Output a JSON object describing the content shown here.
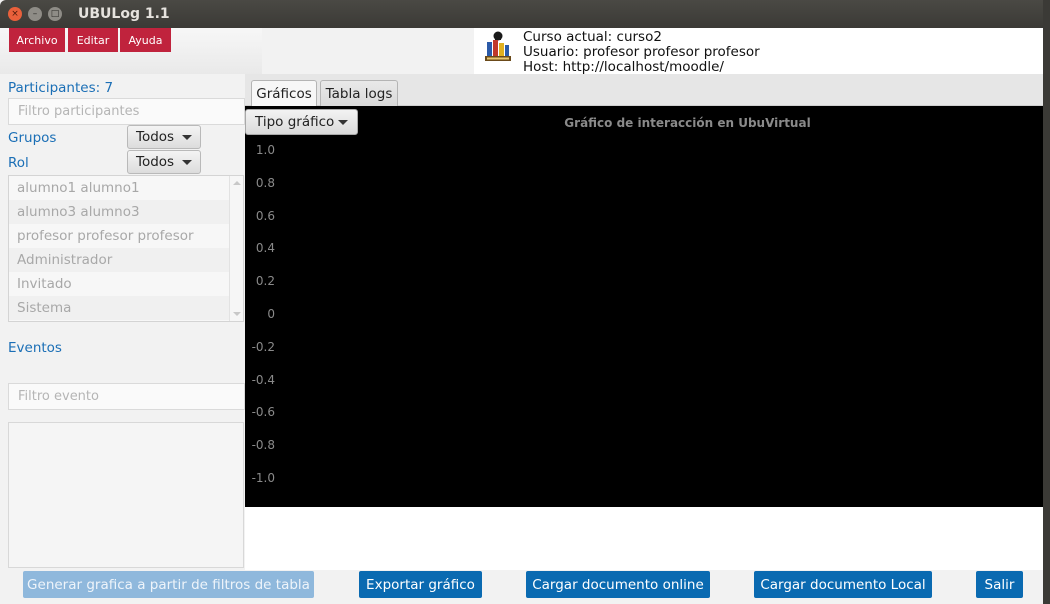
{
  "window": {
    "title": "UBULog 1.1",
    "close_glyph": "×",
    "minimize_glyph": "–",
    "maximize_glyph": "□"
  },
  "menu": {
    "items": [
      "Archivo",
      "Editar",
      "Ayuda"
    ],
    "color": "#c0233d"
  },
  "header": {
    "course": "Curso actual: curso2",
    "user": "Usuario: profesor profesor profesor",
    "host": "Host: http://localhost/moodle/"
  },
  "sidebar": {
    "participants_label": "Participantes: 7",
    "participants_filter_placeholder": "Filtro participantes",
    "groups_label": "Grupos",
    "groups_value": "Todos",
    "role_label": "Rol",
    "role_value": "Todos",
    "list_items": [
      "alumno1 alumno1",
      "alumno3 alumno3",
      "profesor profesor profesor",
      "Administrador",
      "Invitado",
      "Sistema"
    ],
    "events_label": "Eventos",
    "events_filter_placeholder": "Filtro evento"
  },
  "tabs": [
    "Gráficos",
    "Tabla logs"
  ],
  "chart": {
    "type_button": "Tipo gráfico",
    "title": "Gráfico de interacción en UbuVirtual",
    "y_ticks": [
      "1.0",
      "0.8",
      "0.6",
      "0.4",
      "0.2",
      "0",
      "-0.2",
      "-0.4",
      "-0.6",
      "-0.8",
      "-1.0"
    ]
  },
  "chart_data": {
    "type": "line",
    "title": "Gráfico de interacción en UbuVirtual",
    "series": [],
    "ylim": [
      -1.0,
      1.0
    ],
    "yticks": [
      1.0,
      0.8,
      0.6,
      0.4,
      0.2,
      0,
      -0.2,
      -0.4,
      -0.6,
      -0.8,
      -1.0
    ],
    "background": "#000000"
  },
  "footer": {
    "generate": "Generar grafica a partir de filtros de tabla",
    "export": "Exportar gráfico",
    "load_online": "Cargar documento online",
    "load_local": "Cargar documento Local",
    "exit": "Salir"
  },
  "colors": {
    "accent_blue": "#0a6ab1",
    "link_blue": "#1b6fb6",
    "menu_red": "#c0233d"
  }
}
